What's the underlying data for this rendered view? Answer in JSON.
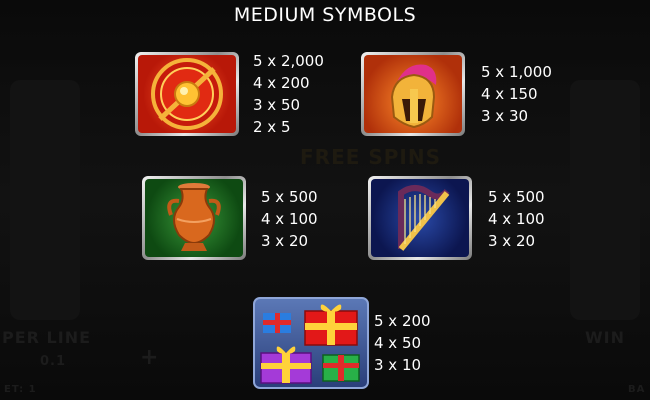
{
  "header": {
    "title": "MEDIUM SYMBOLS"
  },
  "background": {
    "free_spins_watermark": "FREE SPINS",
    "per_line_label": "PER LINE",
    "per_line_value": "0.1",
    "win_label": "WIN",
    "plus_glyph": "+",
    "bet_label": "ET: 1",
    "balance_label": "BA"
  },
  "symbols": [
    {
      "icon": "shield-icon",
      "pays": [
        "5 x 2,000",
        "4 x 200",
        "3 x 50",
        "2 x 5"
      ]
    },
    {
      "icon": "helmet-icon",
      "pays": [
        "5 x 1,000",
        "4 x 150",
        "3 x 30"
      ]
    },
    {
      "icon": "vase-icon",
      "pays": [
        "5 x 500",
        "4 x 100",
        "3 x 20"
      ]
    },
    {
      "icon": "harp-icon",
      "pays": [
        "5 x 500",
        "4 x 100",
        "3 x 20"
      ]
    },
    {
      "icon": "gifts-icon",
      "pays": [
        "5 x 200",
        "4 x 50",
        "3 x 10"
      ]
    }
  ],
  "colors": {
    "text": "#ffffff",
    "frame": "#c8c8c8",
    "bonus_bg": "#3b5595"
  }
}
